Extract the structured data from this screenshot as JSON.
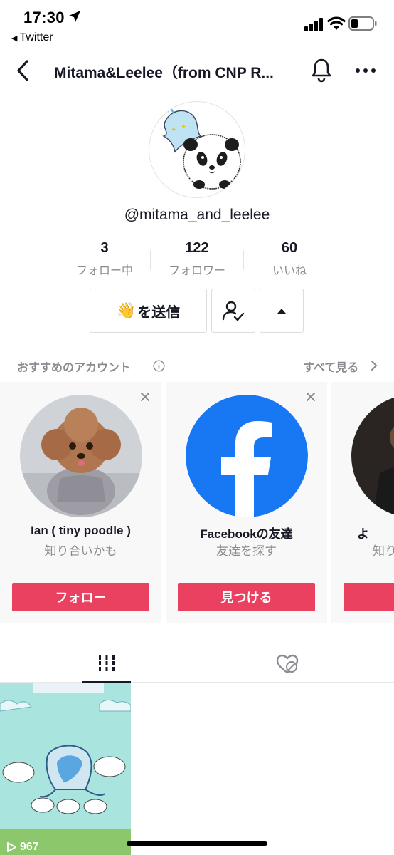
{
  "status_bar": {
    "time": "17:30",
    "back_app": "Twitter",
    "icons": [
      "location-arrow-icon",
      "signal-icon",
      "wifi-icon",
      "battery-icon"
    ]
  },
  "nav": {
    "title": "Mitama&Leelee（from CNP R...",
    "icons": [
      "back-chevron-icon",
      "bell-icon",
      "more-icon"
    ]
  },
  "profile": {
    "handle": "@mitama_and_leelee",
    "stats": [
      {
        "value": "3",
        "label": "フォロー中"
      },
      {
        "value": "122",
        "label": "フォロワー"
      },
      {
        "value": "60",
        "label": "いいね"
      }
    ],
    "send_button": {
      "emoji": "👋",
      "label": "を送信"
    }
  },
  "suggested": {
    "title": "おすすめのアカウント",
    "see_all": "すべて見る",
    "cards": [
      {
        "name": "Ian ( tiny poodle )",
        "sub": "知り合いかも",
        "cta": "フォロー"
      },
      {
        "name": "Facebookの友達",
        "sub": "友達を探す",
        "cta": "見つける"
      },
      {
        "name": "よ",
        "sub": "知り",
        "cta": ""
      }
    ]
  },
  "tabs": {
    "icons": [
      "videos-grid-icon",
      "liked-hidden-icon"
    ]
  },
  "video": {
    "views": "967"
  },
  "colors": {
    "accent": "#ea4160",
    "facebook": "#1877f2",
    "text": "#161823",
    "secondary": "#8a8b91"
  }
}
